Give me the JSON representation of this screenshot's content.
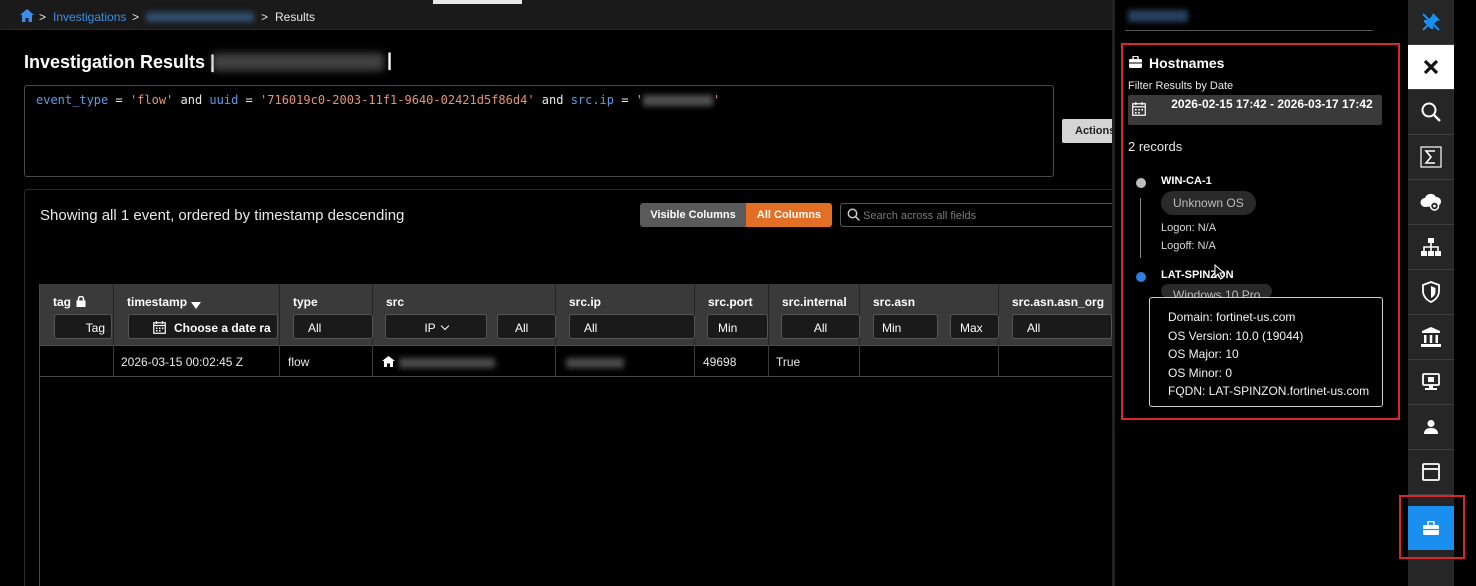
{
  "breadcrumb": {
    "home_icon": "home-icon",
    "sep1": ">",
    "investigations": "Investigations",
    "sep2": ">",
    "sep3": ">",
    "results": "Results"
  },
  "page": {
    "title": "Investigation Results |",
    "title_end": "|"
  },
  "query": {
    "f1": "event_type",
    "op1": " = ",
    "v1": "'flow'",
    "and1": " and ",
    "f2": "uuid",
    "op2": " = ",
    "v2": "'716019c0-2003-11f1-9640-02421d5f86d4'",
    "and2": " and ",
    "f3": "src.ip",
    "op3": " = ",
    "v3_open": "'",
    "v3_close": "'"
  },
  "actions_label": "Actions",
  "results": {
    "summary": "Showing all 1 event, ordered by timestamp descending",
    "visible_columns": "Visible Columns",
    "all_columns": "All Columns",
    "search_placeholder": "Search across all fields"
  },
  "table": {
    "headers": {
      "tag": "tag",
      "timestamp": "timestamp",
      "type": "type",
      "src": "src",
      "src_ip": "src.ip",
      "src_port": "src.port",
      "src_internal": "src.internal",
      "src_asn": "src.asn",
      "src_asn_org": "src.asn.asn_org"
    },
    "filters": {
      "tag": "Tag",
      "timestamp": "Choose a date ra",
      "type": "All",
      "src_ip_mode": "IP",
      "src": "All",
      "src_ip": "All",
      "src_port": "Min",
      "src_internal": "All",
      "src_asn_min": "Min",
      "src_asn_max": "Max",
      "src_asn_org": "All"
    },
    "rows": [
      {
        "tag": "",
        "timestamp": "2026-03-15 00:02:45 Z",
        "type": "flow",
        "src_port": "49698",
        "src_internal": "True",
        "src_asn": "",
        "src_asn_org": ""
      }
    ]
  },
  "hostnames": {
    "title": "Hostnames",
    "filter_label": "Filter Results by Date",
    "date_range": "2026-02-15 17:42  -  2026-03-17 17:42",
    "records": "2 records",
    "hosts": [
      {
        "name": "WIN-CA-1",
        "os": "Unknown OS",
        "logon": "Logon: N/A",
        "logoff": "Logoff: N/A",
        "dot_color": "#bdbdbd"
      },
      {
        "name": "LAT-SPINZON",
        "os": "Windows 10 Pro",
        "dot_color": "#2f7fe0"
      }
    ],
    "tooltip": {
      "domain": "Domain: fortinet-us.com",
      "os_version": "OS Version: 10.0 (19044)",
      "os_major": "OS Major: 10",
      "os_minor": "OS Minor: 0",
      "fqdn": "FQDN: LAT-SPINZON.fortinet-us.com"
    }
  },
  "rail": {
    "items": [
      "pin-off-icon",
      "close-icon",
      "search-icon",
      "sigma-icon",
      "cloud-gear-icon",
      "network-icon",
      "shield-icon",
      "building-icon",
      "computer-icon",
      "user-icon",
      "window-icon",
      "briefcase-icon"
    ],
    "active": "briefcase-icon"
  },
  "colors": {
    "accent_orange": "#e36f26",
    "accent_blue": "#1a8ff0",
    "highlight_red": "#d9272e",
    "link_blue": "#3d8ee6"
  }
}
